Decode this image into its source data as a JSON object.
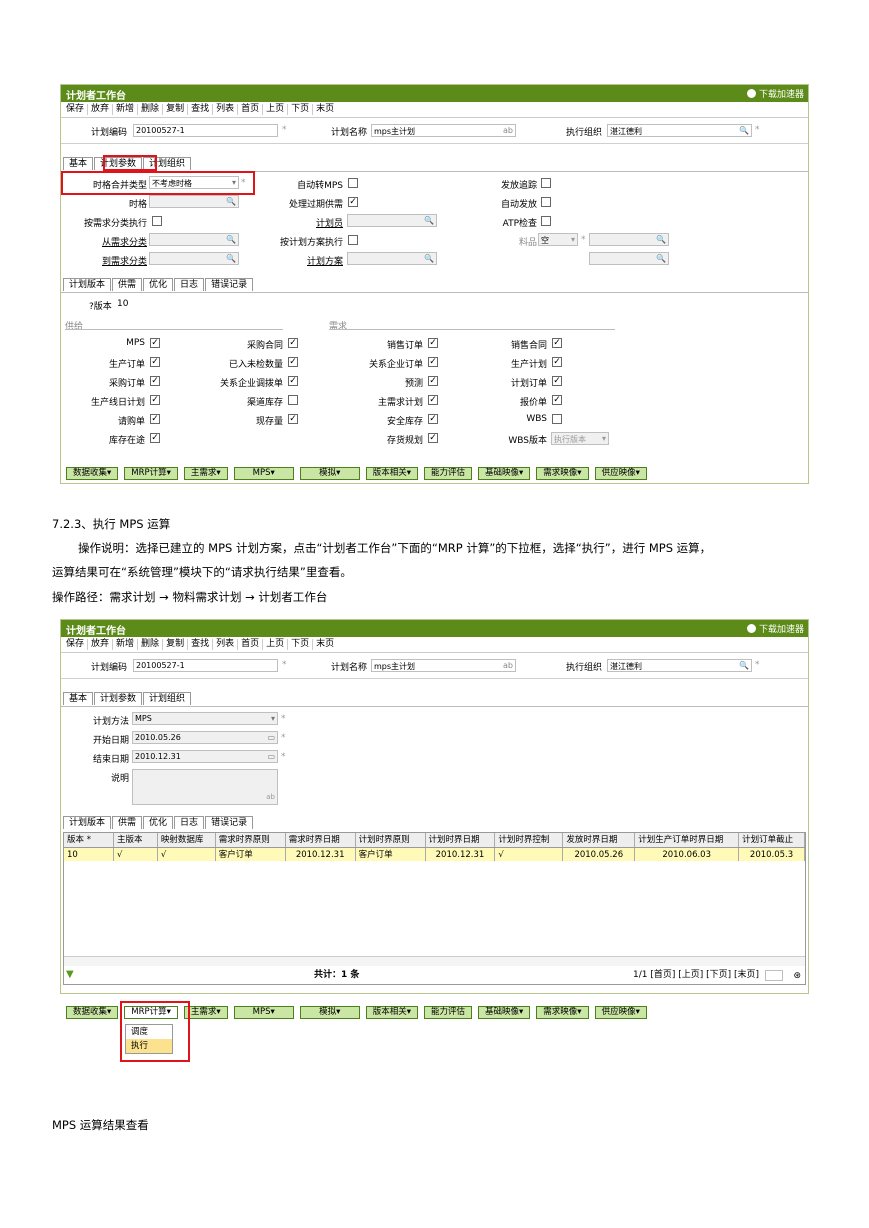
{
  "s1": {
    "title": "计划者工作台",
    "download": "下载加速器",
    "menu": [
      "保存",
      "放弃",
      "新增",
      "删除",
      "复制",
      "查找",
      "列表",
      "首页",
      "上页",
      "下页",
      "末页"
    ],
    "code_label": "计划编码",
    "code_val": "20100527-1",
    "name_label": "计划名称",
    "name_val": "mps主计划",
    "ab": "ab",
    "org_label": "执行组织",
    "org_val": "湛江德利",
    "star": "*",
    "tabs": [
      "基本",
      "计划参数",
      "计划组织"
    ],
    "f_merge_label": "时格合并类型",
    "f_merge_val": "不考虑时格",
    "f_grid": "时格",
    "f_bykind": "按需求分类执行",
    "f_from": "从需求分类",
    "f_to": "到需求分类",
    "f_automps": "自动转MPS",
    "f_overdue": "处理过期供需",
    "f_planner": "计划员",
    "f_byplan": "按计划方案执行",
    "f_planscheme": "计划方案",
    "f_trace": "发放追踪",
    "f_autorelease": "自动发放",
    "f_atp": "ATP检查",
    "f_itemlbl": "料品",
    "f_itemval": "空",
    "subtabs": [
      "计划版本",
      "供需",
      "优化",
      "日志",
      "错误记录"
    ],
    "version_label": "?版本",
    "version_val": "10",
    "supply": "供给",
    "demand": "需求",
    "col1": [
      "MPS",
      "生产订单",
      "采购订单",
      "生产线日计划",
      "请购单",
      "库存在途"
    ],
    "col2": [
      "采购合同",
      "已入未检数量",
      "关系企业调拨单",
      "渠道库存",
      "现存量"
    ],
    "col3": [
      "销售订单",
      "关系企业订单",
      "预测",
      "主需求计划",
      "安全库存",
      "存货规划"
    ],
    "col4": [
      "销售合同",
      "生产计划",
      "计划订单",
      "报价单",
      "WBS",
      "WBS版本"
    ],
    "wbsver": "执行版本",
    "buttons": [
      "数据收集▾",
      "MRP计算▾",
      "主需求▾",
      "MPS▾",
      "模拟▾",
      "版本相关▾",
      "能力评估",
      "基础映像▾",
      "需求映像▾",
      "供应映像▾"
    ]
  },
  "text": {
    "h1": "7.2.3、执行 MPS 运算",
    "p1": "操作说明：选择已建立的 MPS 计划方案，点击“计划者工作台”下面的“MRP 计算”的下拉框，选择“执行”，进行 MPS 运算，",
    "p2": "运算结果可在“系统管理”模块下的“请求执行结果”里查看。",
    "p3": "操作路径：需求计划 → 物料需求计划 → 计划者工作台",
    "foot": "MPS 运算结果查看"
  },
  "s2": {
    "method_label": "计划方法",
    "method_val": "MPS",
    "start_label": "开始日期",
    "start_val": "2010.05.26",
    "end_label": "结束日期",
    "end_val": "2010.12.31",
    "note_label": "说明",
    "grid_headers": [
      "版本 *",
      "主版本",
      "映射数据库",
      "需求时界原则",
      "需求时界日期",
      "计划时界原则",
      "计划时界日期",
      "计划时界控制",
      "发放时界日期",
      "计划生产订单时界日期",
      "计划订单截止"
    ],
    "grid_row": [
      "10",
      "√",
      "√",
      "客户订单",
      "2010.12.31",
      "客户订单",
      "2010.12.31",
      "√",
      "2010.05.26",
      "2010.06.03",
      "2010.05.3"
    ],
    "total": "共计：1 条",
    "pager": "1/1 [首页] [上页] [下页] [末页]",
    "dropdown": [
      "调度",
      "执行"
    ]
  }
}
